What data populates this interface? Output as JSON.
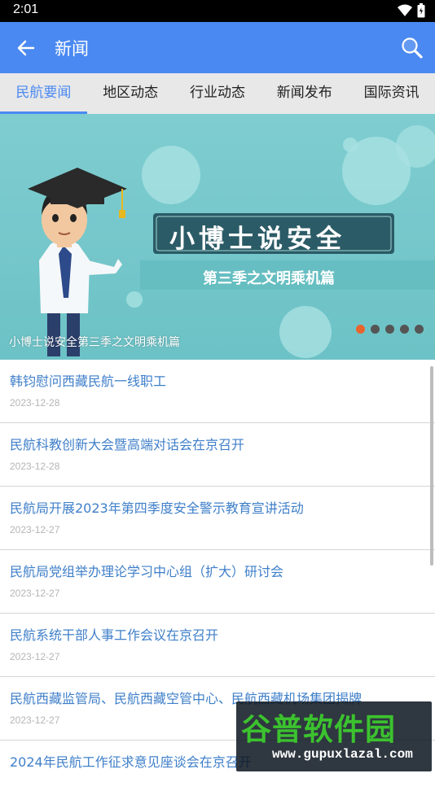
{
  "status_bar": {
    "time": "2:01"
  },
  "app_bar": {
    "title": "新闻",
    "accent": "#4a89f1"
  },
  "tabs": [
    {
      "label": "民航要闻",
      "active": true
    },
    {
      "label": "地区动态",
      "active": false
    },
    {
      "label": "行业动态",
      "active": false
    },
    {
      "label": "新闻发布",
      "active": false
    },
    {
      "label": "国际资讯",
      "active": false
    }
  ],
  "banner": {
    "headline": "小博士说安全",
    "subhead": "第三季之文明乘机篇",
    "caption": "小博士说安全第三季之文明乘机篇",
    "slide_count": 5,
    "active_slide": 1
  },
  "news": [
    {
      "title": "韩钧慰问西藏民航一线职工",
      "date": "2023-12-28"
    },
    {
      "title": "民航科教创新大会暨高端对话会在京召开",
      "date": "2023-12-28"
    },
    {
      "title": "民航局开展2023年第四季度安全警示教育宣讲活动",
      "date": "2023-12-27"
    },
    {
      "title": "民航局党组举办理论学习中心组（扩大）研讨会",
      "date": "2023-12-27"
    },
    {
      "title": "民航系统干部人事工作会议在京召开",
      "date": "2023-12-27"
    },
    {
      "title": "民航西藏监管局、民航西藏空管中心、民航西藏机场集团揭牌",
      "date": "2023-12-27"
    },
    {
      "title": "2024年民航工作征求意见座谈会在京召开",
      "date": ""
    }
  ],
  "watermark": {
    "main": "谷普软件园",
    "url": "www.gupuxlazal.com"
  }
}
